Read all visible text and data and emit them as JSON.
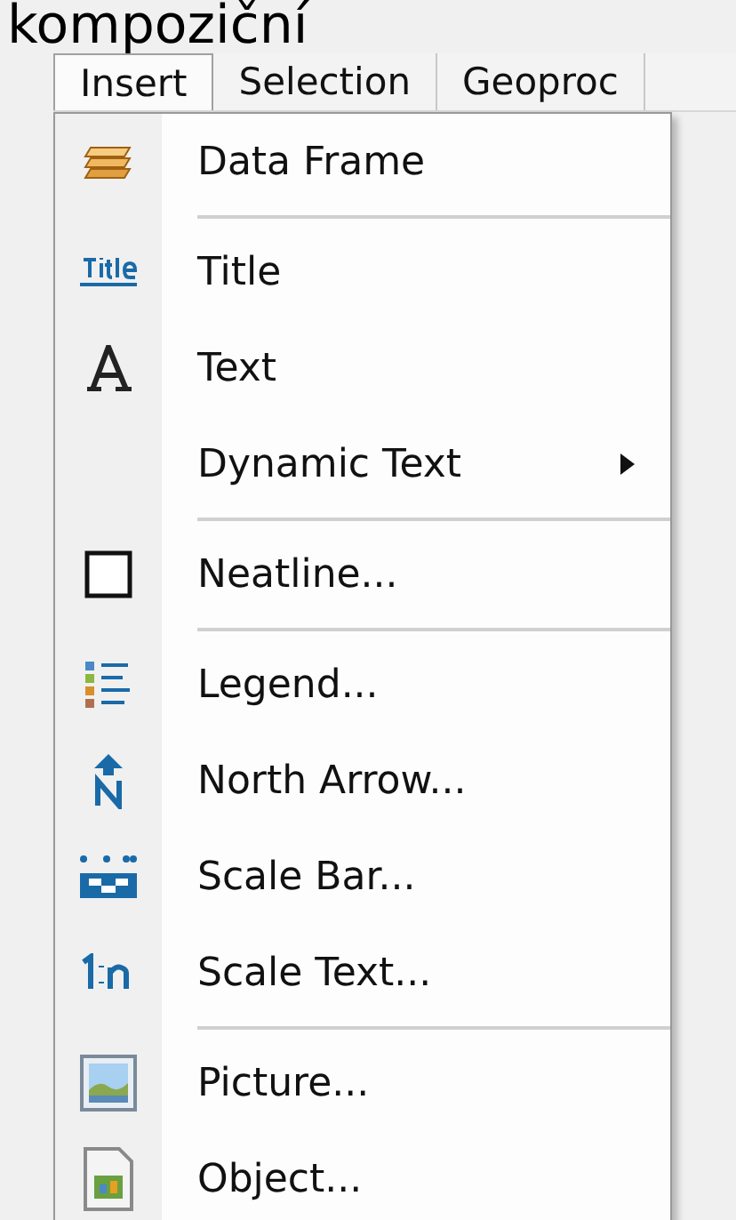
{
  "caption": "kompoziční",
  "menubar": [
    {
      "label": "Insert",
      "selected": true
    },
    {
      "label": "Selection",
      "selected": false
    },
    {
      "label": "Geoproc",
      "selected": false
    }
  ],
  "menu": [
    {
      "kind": "item",
      "label": "Data Frame",
      "submenu": false
    },
    {
      "kind": "separator"
    },
    {
      "kind": "item",
      "label": "Title",
      "submenu": false
    },
    {
      "kind": "item",
      "label": "Text",
      "submenu": false
    },
    {
      "kind": "item",
      "label": "Dynamic Text",
      "submenu": true
    },
    {
      "kind": "separator"
    },
    {
      "kind": "item",
      "label": "Neatline...",
      "submenu": false
    },
    {
      "kind": "separator"
    },
    {
      "kind": "item",
      "label": "Legend...",
      "submenu": false
    },
    {
      "kind": "item",
      "label": "North Arrow...",
      "submenu": false
    },
    {
      "kind": "item",
      "label": "Scale Bar...",
      "submenu": false
    },
    {
      "kind": "item",
      "label": "Scale Text...",
      "submenu": false
    },
    {
      "kind": "separator"
    },
    {
      "kind": "item",
      "label": "Picture...",
      "submenu": false
    },
    {
      "kind": "item",
      "label": "Object...",
      "submenu": false
    }
  ]
}
